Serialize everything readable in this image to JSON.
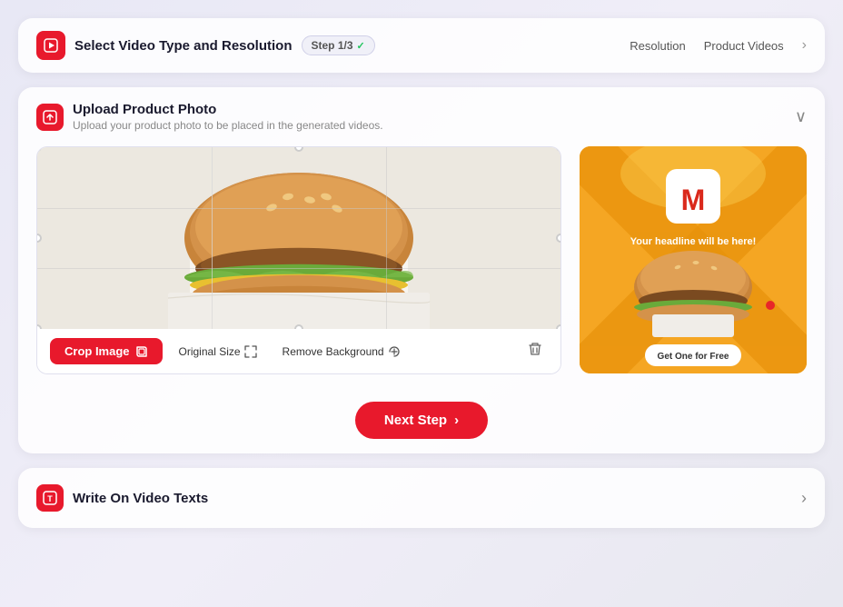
{
  "header": {
    "title": "Select Video Type and Resolution",
    "step_badge": "Step 1/3",
    "step_check": "✓",
    "nav_items": [
      "Resolution",
      "Product Videos"
    ],
    "chevron": "›"
  },
  "upload_section": {
    "title": "Upload Product Photo",
    "subtitle": "Upload your product photo to be placed in the generated videos.",
    "collapse_icon": "∨"
  },
  "toolbar": {
    "crop_label": "Crop Image",
    "crop_icon": "⊞",
    "original_label": "Original Size",
    "original_icon": "⤢",
    "remove_bg_label": "Remove Background",
    "remove_bg_icon": "✦",
    "delete_icon": "🗑"
  },
  "next_step": {
    "label": "Next Step",
    "icon": "›"
  },
  "preview": {
    "headline": "Your headline will be here!",
    "cta": "Get One for Free",
    "bg_color": "#f5a623"
  },
  "write_section": {
    "title": "Write On Video Texts",
    "chevron": "›"
  },
  "icons": {
    "video_play": "▶",
    "upload_arrow": "↑",
    "write_T": "T"
  }
}
